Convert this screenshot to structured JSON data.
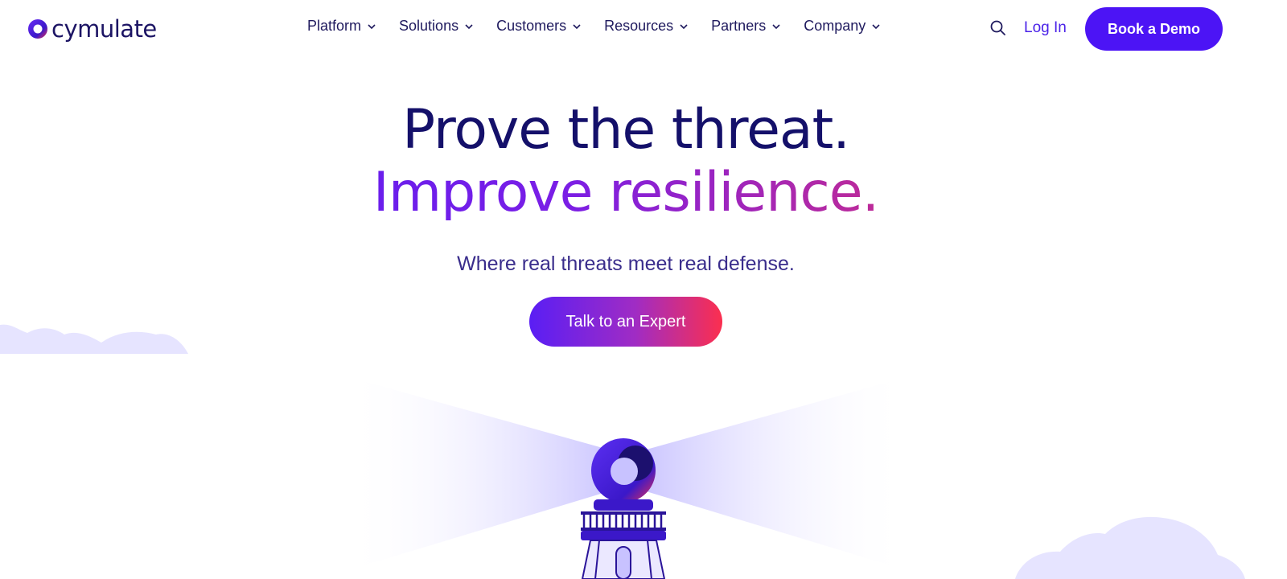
{
  "brand": {
    "name": "cymulate"
  },
  "nav": {
    "items": [
      {
        "label": "Platform"
      },
      {
        "label": "Solutions"
      },
      {
        "label": "Customers"
      },
      {
        "label": "Resources"
      },
      {
        "label": "Partners"
      },
      {
        "label": "Company"
      }
    ]
  },
  "header": {
    "login_label": "Log In",
    "demo_label": "Book a Demo"
  },
  "hero": {
    "title_line1": "Prove the threat.",
    "title_line2": "Improve resilience.",
    "subtitle": "Where real threats meet real defense.",
    "cta_label": "Talk to an Expert"
  },
  "colors": {
    "brand_purple": "#4c14f5",
    "navy": "#14106a",
    "gradient_end": "#f0304e"
  },
  "icons": {
    "search": "search-icon",
    "chevron": "chevron-down-icon"
  }
}
